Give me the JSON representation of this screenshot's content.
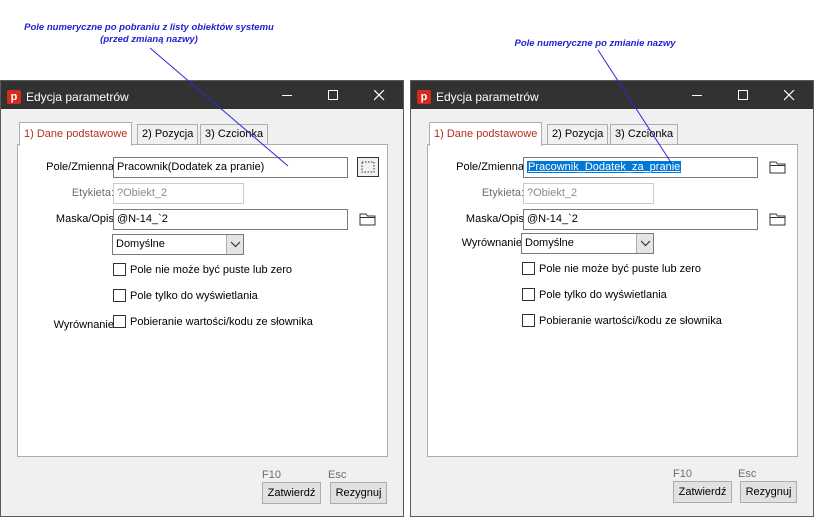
{
  "annotations": {
    "left": [
      "Pole numeryczne po pobraniu z listy obiektów systemu",
      "(przed zmianą nazwy)"
    ],
    "right": "Pole numeryczne po zmianie nazwy"
  },
  "colors": {
    "annotation": "#1f1fcf",
    "titlebar": "#323232",
    "app_icon": "#d42b1e",
    "active_tab_text": "#b3301c",
    "selection": "#0078d7"
  },
  "dialogs": [
    {
      "title": "Edycja parametrów",
      "app_icon_letter": "p",
      "tabs": [
        "1) Dane podstawowe",
        "2) Pozycja",
        "3) Czcionka"
      ],
      "active_tab": 0,
      "fields": {
        "pole_label": "Pole/Zmienna",
        "pole_value": "Pracownik(Dodatek za pranie)",
        "pole_button_icon": "select-object-icon",
        "etykieta_label": "Etykieta:",
        "etykieta_value": "?Obiekt_2",
        "maska_label": "Maska/Opis",
        "maska_value": "@N-14_`2",
        "maska_button_icon": "folder-icon",
        "wyrownanie_label": "Wyrównanie",
        "wyrownanie_value": "Domyślne"
      },
      "checkboxes": [
        {
          "label": "Pole nie może być puste lub zero",
          "checked": false
        },
        {
          "label": "Pole tylko do wyświetlania",
          "checked": false
        },
        {
          "label": "Pobieranie wartości/kodu ze słownika",
          "checked": false
        }
      ],
      "footer": {
        "confirm_key": "F10",
        "confirm_label": "Zatwierdź",
        "cancel_key": "Esc",
        "cancel_label": "Rezygnuj"
      }
    },
    {
      "title": "Edycja parametrów",
      "app_icon_letter": "p",
      "tabs": [
        "1) Dane podstawowe",
        "2) Pozycja",
        "3) Czcionka"
      ],
      "active_tab": 0,
      "fields": {
        "pole_label": "Pole/Zmienna",
        "pole_value": "Pracownik_Dodatek_za_pranie",
        "pole_button_icon": "folder-icon",
        "etykieta_label": "Etykieta:",
        "etykieta_value": "?Obiekt_2",
        "maska_label": "Maska/Opis",
        "maska_value": "@N-14_`2",
        "maska_button_icon": "folder-icon",
        "wyrownanie_label": "Wyrównanie",
        "wyrownanie_value": "Domyślne"
      },
      "checkboxes": [
        {
          "label": "Pole nie może być puste lub zero",
          "checked": false
        },
        {
          "label": "Pole tylko do wyświetlania",
          "checked": false
        },
        {
          "label": "Pobieranie wartości/kodu ze słownika",
          "checked": false
        }
      ],
      "footer": {
        "confirm_key": "F10",
        "confirm_label": "Zatwierdź",
        "cancel_key": "Esc",
        "cancel_label": "Rezygnuj"
      }
    }
  ]
}
